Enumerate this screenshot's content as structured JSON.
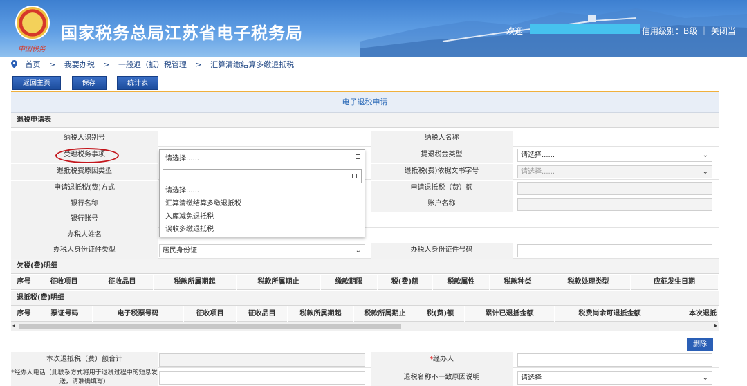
{
  "header": {
    "brand_script": "中国税务",
    "title": "国家税务总局江苏省电子税务局",
    "welcome": "欢迎",
    "credit": "信用级别：B级 ｜ 关闭当"
  },
  "breadcrumb": [
    "首页",
    ">",
    "我要办税",
    ">",
    "一般退（抵）税管理",
    ">",
    "汇算清缴结算多缴退抵税"
  ],
  "toolbar": {
    "back": "返回主页",
    "save": "保存",
    "stats": "统计表"
  },
  "form": {
    "title": "电子退税申请",
    "section1": "退税申请表",
    "rows": [
      {
        "l1": "纳税人识别号",
        "v1": "",
        "l2": "纳税人名称",
        "v2": ""
      },
      {
        "l1": "受理税务事项",
        "v1": "请选择......",
        "l2": "提退税金类型",
        "v2": "请选择......"
      },
      {
        "l1": "退抵税费原因类型",
        "v1": "",
        "l2": "退抵税(费)依据文书字号",
        "v2": "请选择......"
      },
      {
        "l1": "申请退抵税(费)方式",
        "v1": "",
        "l2": "申请退抵税（费）额",
        "v2": ""
      },
      {
        "l1": "银行名称",
        "v1": "",
        "l2": "账户名称",
        "v2": ""
      },
      {
        "l1": "银行账号",
        "v1": "",
        "l2": "",
        "v2": ""
      },
      {
        "l1": "办税人姓名",
        "v1": "",
        "l2": "",
        "v2": ""
      },
      {
        "l1": "办税人身份证件类型",
        "v1": "居民身份证",
        "l2": "办税人身份证件号码",
        "v2": ""
      }
    ],
    "dropdown": {
      "selected": "请选择......",
      "options": [
        "请选择......",
        "汇算清缴结算多缴退抵税",
        "入库减免退抵税",
        "误收多缴退抵税"
      ]
    },
    "arrears_title": "欠税(费)明细",
    "arrears_cols": [
      "序号",
      "征收项目",
      "征收品目",
      "税款所属期起",
      "税款所属期止",
      "缴款期限",
      "税(费)额",
      "税款属性",
      "税款种类",
      "税款处理类型",
      "应征发生日期"
    ],
    "refund_title": "退抵税(费)明细",
    "refund_cols": [
      "序号",
      "票证号码",
      "电子税票号码",
      "征收项目",
      "征收品目",
      "税款所属期起",
      "税款所属期止",
      "税(费)额",
      "累计已退抵金额",
      "税费尚余可退抵金额",
      "本次退抵"
    ],
    "delete": "删除",
    "total_label": "本次退抵税（费）额合计",
    "handler_label": "经办人",
    "handler_star": "*",
    "phone_label": "*经办人电话（此联系方式将用于退税过程中的短息发送，请准确填写）",
    "mismatch_label": "退税名称不一致原因说明",
    "mismatch_value": "请选择"
  }
}
